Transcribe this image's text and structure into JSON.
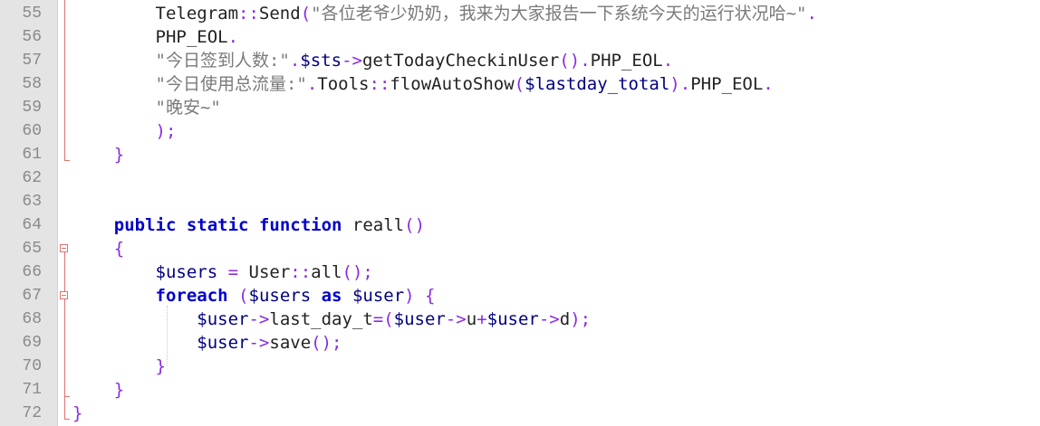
{
  "lines": [
    {
      "num": "55",
      "tokens": [
        {
          "t": "        "
        },
        {
          "t": "Telegram",
          "c": "def"
        },
        {
          "t": "::",
          "c": "op"
        },
        {
          "t": "Send",
          "c": "def"
        },
        {
          "t": "(",
          "c": "op"
        },
        {
          "t": "\"各位老爷少奶奶，我来为大家报告一下系统今天的运行状况哈~\"",
          "c": "str"
        },
        {
          "t": ".",
          "c": "op"
        }
      ]
    },
    {
      "num": "56",
      "tokens": [
        {
          "t": "        "
        },
        {
          "t": "PHP_EOL",
          "c": "def"
        },
        {
          "t": ".",
          "c": "op"
        }
      ]
    },
    {
      "num": "57",
      "tokens": [
        {
          "t": "        "
        },
        {
          "t": "\"今日签到人数:\"",
          "c": "str"
        },
        {
          "t": ".",
          "c": "op"
        },
        {
          "t": "$sts",
          "c": "var"
        },
        {
          "t": "->",
          "c": "op"
        },
        {
          "t": "getTodayCheckinUser",
          "c": "def"
        },
        {
          "t": "()",
          "c": "op"
        },
        {
          "t": ".",
          "c": "op"
        },
        {
          "t": "PHP_EOL",
          "c": "def"
        },
        {
          "t": ".",
          "c": "op"
        }
      ]
    },
    {
      "num": "58",
      "tokens": [
        {
          "t": "        "
        },
        {
          "t": "\"今日使用总流量:\"",
          "c": "str"
        },
        {
          "t": ".",
          "c": "op"
        },
        {
          "t": "Tools",
          "c": "def"
        },
        {
          "t": "::",
          "c": "op"
        },
        {
          "t": "flowAutoShow",
          "c": "def"
        },
        {
          "t": "(",
          "c": "op"
        },
        {
          "t": "$lastday_total",
          "c": "var"
        },
        {
          "t": ")",
          "c": "op"
        },
        {
          "t": ".",
          "c": "op"
        },
        {
          "t": "PHP_EOL",
          "c": "def"
        },
        {
          "t": ".",
          "c": "op"
        }
      ]
    },
    {
      "num": "59",
      "tokens": [
        {
          "t": "        "
        },
        {
          "t": "\"晚安~\"",
          "c": "str"
        }
      ]
    },
    {
      "num": "60",
      "tokens": [
        {
          "t": "        "
        },
        {
          "t": ");",
          "c": "op"
        }
      ]
    },
    {
      "num": "61",
      "tokens": [
        {
          "t": "    "
        },
        {
          "t": "}",
          "c": "op"
        }
      ]
    },
    {
      "num": "62",
      "tokens": []
    },
    {
      "num": "63",
      "tokens": []
    },
    {
      "num": "64",
      "tokens": [
        {
          "t": "    "
        },
        {
          "t": "public",
          "c": "kw"
        },
        {
          "t": " "
        },
        {
          "t": "static",
          "c": "kw"
        },
        {
          "t": " "
        },
        {
          "t": "function",
          "c": "kw"
        },
        {
          "t": " "
        },
        {
          "t": "reall",
          "c": "def"
        },
        {
          "t": "()",
          "c": "op"
        }
      ]
    },
    {
      "num": "65",
      "tokens": [
        {
          "t": "    "
        },
        {
          "t": "{",
          "c": "op"
        }
      ]
    },
    {
      "num": "66",
      "tokens": [
        {
          "t": "        "
        },
        {
          "t": "$users",
          "c": "var"
        },
        {
          "t": " "
        },
        {
          "t": "=",
          "c": "op"
        },
        {
          "t": " "
        },
        {
          "t": "User",
          "c": "def"
        },
        {
          "t": "::",
          "c": "op"
        },
        {
          "t": "all",
          "c": "def"
        },
        {
          "t": "();",
          "c": "op"
        }
      ]
    },
    {
      "num": "67",
      "tokens": [
        {
          "t": "        "
        },
        {
          "t": "foreach",
          "c": "kw"
        },
        {
          "t": " "
        },
        {
          "t": "(",
          "c": "op"
        },
        {
          "t": "$users",
          "c": "var"
        },
        {
          "t": " "
        },
        {
          "t": "as",
          "c": "kw"
        },
        {
          "t": " "
        },
        {
          "t": "$user",
          "c": "var"
        },
        {
          "t": ")",
          "c": "op"
        },
        {
          "t": " "
        },
        {
          "t": "{",
          "c": "op"
        }
      ]
    },
    {
      "num": "68",
      "tokens": [
        {
          "t": "            "
        },
        {
          "t": "$user",
          "c": "var"
        },
        {
          "t": "->",
          "c": "op"
        },
        {
          "t": "last_day_t",
          "c": "def"
        },
        {
          "t": "=(",
          "c": "op"
        },
        {
          "t": "$user",
          "c": "var"
        },
        {
          "t": "->",
          "c": "op"
        },
        {
          "t": "u",
          "c": "def"
        },
        {
          "t": "+",
          "c": "op"
        },
        {
          "t": "$user",
          "c": "var"
        },
        {
          "t": "->",
          "c": "op"
        },
        {
          "t": "d",
          "c": "def"
        },
        {
          "t": ");",
          "c": "op"
        }
      ]
    },
    {
      "num": "69",
      "tokens": [
        {
          "t": "            "
        },
        {
          "t": "$user",
          "c": "var"
        },
        {
          "t": "->",
          "c": "op"
        },
        {
          "t": "save",
          "c": "def"
        },
        {
          "t": "();",
          "c": "op"
        }
      ]
    },
    {
      "num": "70",
      "tokens": [
        {
          "t": "        "
        },
        {
          "t": "}",
          "c": "op"
        }
      ]
    },
    {
      "num": "71",
      "tokens": [
        {
          "t": "    "
        },
        {
          "t": "}",
          "c": "op"
        }
      ]
    },
    {
      "num": "72",
      "tokens": [
        {
          "t": "}",
          "c": "op"
        }
      ]
    }
  ]
}
